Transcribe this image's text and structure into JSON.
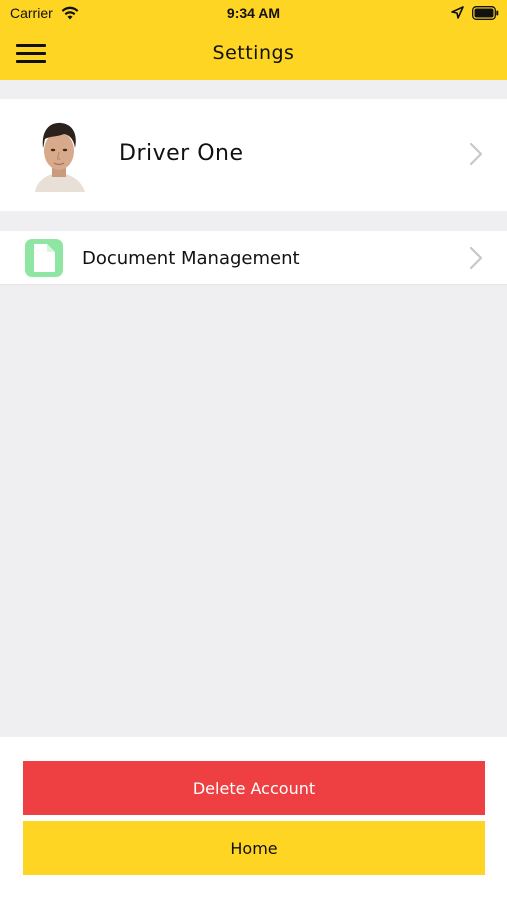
{
  "status_bar": {
    "carrier": "Carrier",
    "time": "9:34 AM"
  },
  "header": {
    "title": "Settings"
  },
  "profile": {
    "name": "Driver One"
  },
  "menu": {
    "document_management": "Document Management"
  },
  "actions": {
    "delete_account": "Delete Account",
    "home": "Home"
  },
  "colors": {
    "accent_yellow": "#fed523",
    "danger_red": "#ee4043",
    "doc_icon_green": "#8fe6a3",
    "background": "#efeff1"
  },
  "icons": [
    "wifi-icon",
    "location-arrow-icon",
    "battery-icon",
    "hamburger-menu-icon",
    "chevron-right-icon",
    "document-icon"
  ]
}
